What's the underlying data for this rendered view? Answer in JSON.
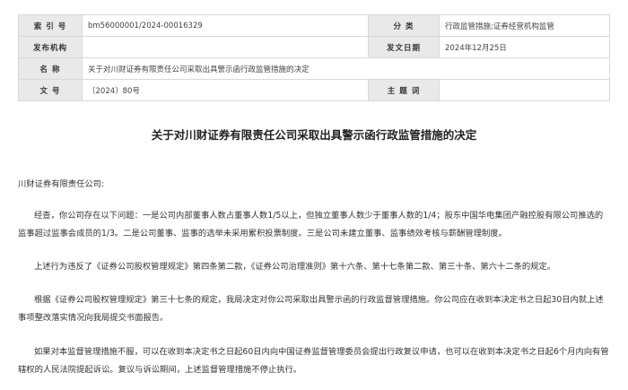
{
  "meta": {
    "index_label": "索 引 号",
    "index_value": "bm56000001/2024-00016329",
    "category_label": "分    类",
    "category_value": "行政监管措施;证券经营机构监管",
    "publisher_label": "发布机构",
    "publisher_value": "",
    "date_label": "发文日期",
    "date_value": "2024年12月25日",
    "name_label": "名    称",
    "name_value": "关于对川财证券有限责任公司采取出具警示函行政监管措施的决定",
    "doc_label": "文    号",
    "doc_value": "〔2024〕80号",
    "subject_label": "主 题 词",
    "subject_value": ""
  },
  "document": {
    "title": "关于对川财证券有限责任公司采取出具警示函行政监管措施的决定",
    "salutation": "川财证券有限责任公司:",
    "para1": "经查，你公司存在以下问题：一是公司内部董事人数占董事人数1/5以上，但独立董事人数少于董事人数的1/4；股东中国华电集团产融控股有限公司推选的监事超过监事会成员的1/3。二是公司董事、监事的选举未采用累积投票制度。三是公司未建立董事、监事绩效考核与薪酬管理制度。",
    "para2": "上述行为违反了《证券公司股权管理规定》第四条第二款，《证券公司治理准则》第十六条、第十七条第二款、第三十条、第六十二条的规定。",
    "para3": "根据《证券公司股权管理规定》第三十七条的规定，我局决定对你公司采取出具警示函的行政监督管理措施。你公司应在收到本决定书之日起30日内就上述事项整改落实情况向我局提交书面报告。",
    "para4": "如果对本监督管理措施不服，可以在收到本决定书之日起60日内向中国证券监督管理委员会提出行政复议申请，也可以在收到本决定书之日起6个月内向有管辖权的人民法院提起诉讼。复议与诉讼期间，上述监督管理措施不停止执行。"
  }
}
